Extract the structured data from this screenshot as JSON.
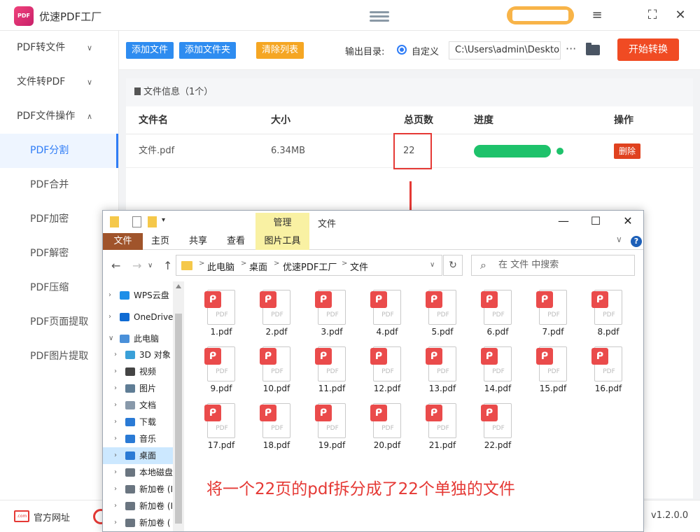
{
  "app": {
    "logo_text": "PDF",
    "title": "优速PDF工厂",
    "window_controls": [
      "≡",
      "⛶",
      "✕"
    ]
  },
  "sidebar": {
    "groups": [
      {
        "label": "PDF转文件",
        "chevron": "chevron-down"
      },
      {
        "label": "文件转PDF",
        "chevron": "chevron-down"
      },
      {
        "label": "PDF文件操作",
        "chevron": "chevron-up"
      }
    ],
    "subitems": [
      "PDF分割",
      "PDF合并",
      "PDF加密",
      "PDF解密",
      "PDF压缩",
      "PDF页面提取",
      "PDF图片提取"
    ],
    "active": "PDF分割"
  },
  "toolbar": {
    "add_file": "添加文件",
    "add_folder": "添加文件夹",
    "clear_list": "清除列表",
    "output_label": "输出目录:",
    "radio_label": "自定义",
    "path_value": "C:\\Users\\admin\\Deskto",
    "more": "···",
    "start": "开始转换",
    "colors": {
      "blue": "#2e8cf0",
      "orange": "#f5a623",
      "red": "#f04b23"
    }
  },
  "file_panel": {
    "header": "文件信息（1个）",
    "columns": [
      "文件名",
      "大小",
      "总页数",
      "进度",
      "操作"
    ],
    "rows": [
      {
        "name": "文件.pdf",
        "size": "6.34MB",
        "pages": "22",
        "progress": 1.0,
        "action": "删除"
      }
    ]
  },
  "bottom": {
    "site_icon_text": ".com",
    "site_label": "官方网址",
    "version": "v1.2.0.0"
  },
  "explorer": {
    "manage_tab": "管理",
    "title": "文件",
    "ribbon_tabs": [
      "文件",
      "主页",
      "共享",
      "查看",
      "图片工具"
    ],
    "window_controls": [
      "—",
      "☐",
      "✕"
    ],
    "breadcrumb": [
      "此电脑",
      "桌面",
      "优速PDF工厂",
      "文件"
    ],
    "search_placeholder": "在 文件 中搜索",
    "nav": [
      {
        "label": "WPS云盘",
        "icon": "cloud-icon",
        "color": "#1e8fe8"
      },
      {
        "label": "OneDrive",
        "icon": "onedrive-icon",
        "color": "#0f6bd3"
      },
      {
        "label": "此电脑",
        "icon": "computer-icon",
        "color": "#4a90d9"
      },
      {
        "label": "3D 对象",
        "icon": "cube-icon",
        "color": "#3aa0d8"
      },
      {
        "label": "视频",
        "icon": "film-icon",
        "color": "#444444"
      },
      {
        "label": "图片",
        "icon": "picture-icon",
        "color": "#5f7d95"
      },
      {
        "label": "文档",
        "icon": "document-icon",
        "color": "#8899aa"
      },
      {
        "label": "下载",
        "icon": "download-icon",
        "color": "#2a7ad5"
      },
      {
        "label": "音乐",
        "icon": "music-icon",
        "color": "#2a7ad5"
      },
      {
        "label": "桌面",
        "icon": "desktop-icon",
        "color": "#2a7ad5"
      },
      {
        "label": "本地磁盘",
        "icon": "drive-icon",
        "color": "#6a7580"
      },
      {
        "label": "新加卷 (I",
        "icon": "drive-icon",
        "color": "#6a7580"
      },
      {
        "label": "新加卷 (I",
        "icon": "drive-icon",
        "color": "#6a7580"
      },
      {
        "label": "新加卷 (",
        "icon": "drive-icon",
        "color": "#6a7580"
      }
    ],
    "files": [
      "1.pdf",
      "2.pdf",
      "3.pdf",
      "4.pdf",
      "5.pdf",
      "6.pdf",
      "7.pdf",
      "8.pdf",
      "9.pdf",
      "10.pdf",
      "11.pdf",
      "12.pdf",
      "13.pdf",
      "14.pdf",
      "15.pdf",
      "16.pdf",
      "17.pdf",
      "18.pdf",
      "19.pdf",
      "20.pdf",
      "21.pdf",
      "22.pdf"
    ],
    "caption": "将一个22页的pdf拆分成了22个单独的文件"
  }
}
